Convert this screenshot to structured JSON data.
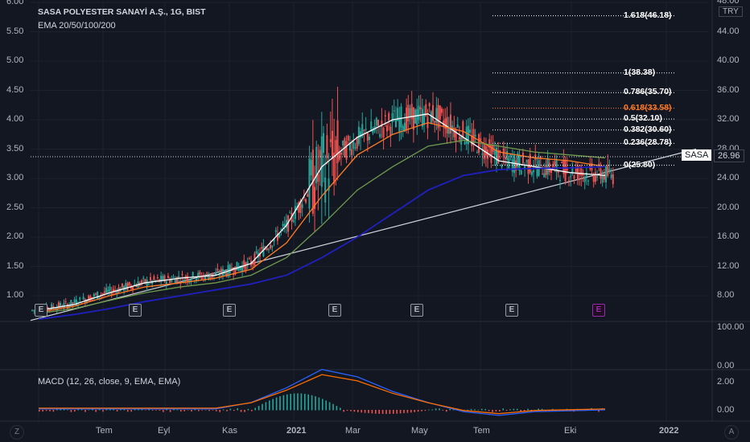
{
  "header": {
    "title": "SASA POLYESTER SANAYİ A.Ş., 1G, BIST",
    "ema": "EMA 20/50/100/200",
    "macd": "MACD (12, 26, close, 9, EMA, EMA)"
  },
  "currency": "TRY",
  "symbol_tag": "SASA",
  "price_tag": "26.96",
  "left_axis": [
    "6.00",
    "5.50",
    "5.00",
    "4.50",
    "4.00",
    "3.50",
    "3.00",
    "2.50",
    "2.00",
    "1.50",
    "1.00"
  ],
  "right_axis": [
    "48.00",
    "44.00",
    "40.00",
    "36.00",
    "32.00",
    "28.00",
    "24.00",
    "20.00",
    "16.00",
    "12.00",
    "8.00"
  ],
  "rsi_axis": [
    "100.00",
    "0.00"
  ],
  "macd_axis": [
    "2.00",
    "0.00"
  ],
  "x_axis": [
    "Tem",
    "Eyl",
    "Kas",
    "2021",
    "Mar",
    "May",
    "Tem",
    "Eki",
    "2022"
  ],
  "fib_levels": [
    {
      "label": "1.618(46.18)",
      "value": 46.18,
      "color": "#ffffff"
    },
    {
      "label": "1(38.38)",
      "value": 38.38,
      "color": "#ffffff"
    },
    {
      "label": "0.786(35.70)",
      "value": 35.7,
      "color": "#ffffff"
    },
    {
      "label": "0.618(33.58)",
      "value": 33.58,
      "color": "#ff7b25"
    },
    {
      "label": "0.5(32.10)",
      "value": 32.1,
      "color": "#ffffff"
    },
    {
      "label": "0.382(30.60)",
      "value": 30.6,
      "color": "#ffffff"
    },
    {
      "label": "0.236(28.78)",
      "value": 28.78,
      "color": "#ffffff"
    },
    {
      "label": "0(25.80)",
      "value": 25.8,
      "color": "#ffffff"
    }
  ],
  "earnings_marker": "E",
  "corner_left": "Z",
  "corner_right": "A",
  "colors": {
    "up": "#26a69a",
    "down": "#ef5350",
    "ema20": "#ffffff",
    "ema50": "#ff7b25",
    "ema100": "#6f9a4d",
    "ema200": "#2020c0",
    "macd": "#2962ff",
    "signal": "#ff6d00",
    "trendline": "#d1d4dc"
  },
  "chart_data": {
    "type": "line",
    "title": "SASA POLYESTER SANAYİ A.Ş., 1G, BIST",
    "x": [
      "2020-06",
      "2020-07",
      "2020-08",
      "2020-09",
      "2020-10",
      "2020-11",
      "2020-12",
      "2021-01",
      "2021-02",
      "2021-03",
      "2021-04",
      "2021-05",
      "2021-06",
      "2021-07",
      "2021-08",
      "2021-09",
      "2021-10"
    ],
    "series": [
      {
        "name": "EMA 20",
        "values": [
          0.75,
          0.85,
          1.05,
          1.22,
          1.3,
          1.35,
          1.55,
          2.2,
          3.2,
          3.7,
          4.0,
          4.1,
          3.7,
          3.3,
          3.2,
          3.1,
          3.05
        ]
      },
      {
        "name": "EMA 50",
        "values": [
          0.72,
          0.82,
          1.0,
          1.15,
          1.22,
          1.3,
          1.45,
          1.9,
          2.7,
          3.4,
          3.75,
          3.95,
          3.8,
          3.45,
          3.35,
          3.3,
          3.2
        ]
      },
      {
        "name": "EMA 100",
        "values": [
          0.7,
          0.78,
          0.92,
          1.05,
          1.15,
          1.22,
          1.35,
          1.65,
          2.2,
          2.8,
          3.2,
          3.55,
          3.65,
          3.55,
          3.45,
          3.4,
          3.35
        ]
      },
      {
        "name": "EMA 200",
        "values": [
          0.6,
          0.68,
          0.78,
          0.9,
          1.0,
          1.1,
          1.2,
          1.35,
          1.65,
          2.0,
          2.4,
          2.8,
          3.05,
          3.15,
          3.17,
          3.18,
          3.2
        ]
      }
    ],
    "price_range": [
      0.7,
      6.0
    ],
    "ylim_left": [
      0.7,
      6.0
    ],
    "ylim_right": [
      4.0,
      48.0
    ],
    "rsi_range": [
      0,
      100
    ],
    "macd_range": [
      -0.3,
      2.3
    ],
    "trendline": {
      "from": [
        "2020-06",
        0.58
      ],
      "to": [
        "2022-01",
        3.5
      ]
    },
    "last_price": 26.96
  }
}
